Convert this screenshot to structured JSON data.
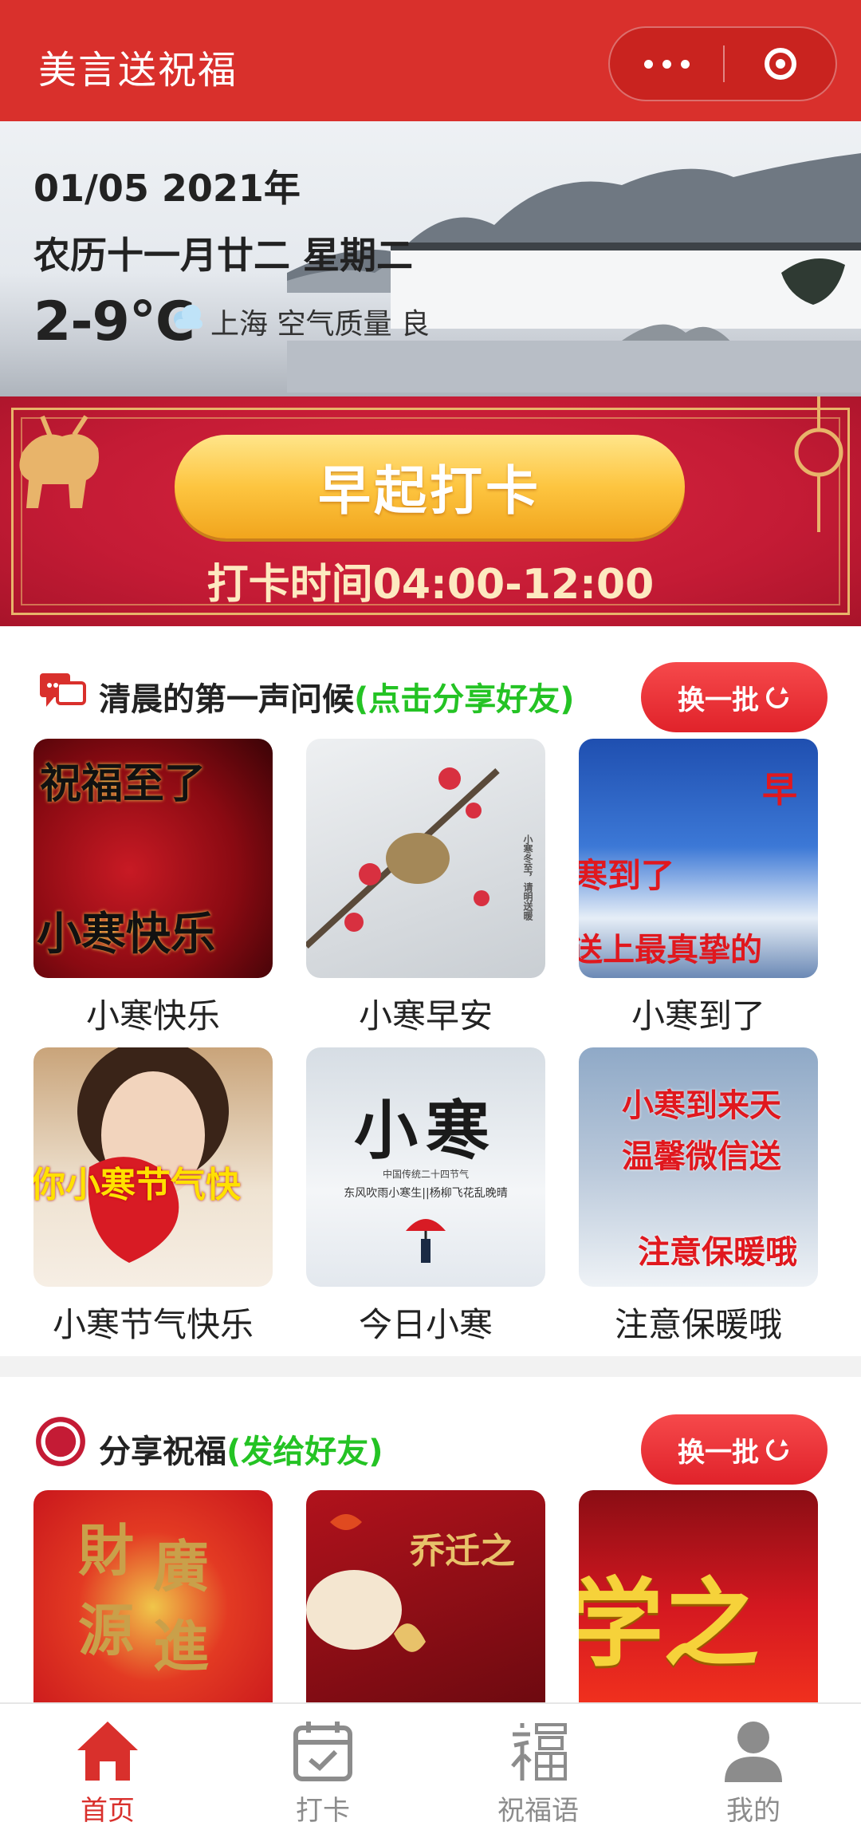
{
  "header": {
    "title": "美言送祝福"
  },
  "weather": {
    "date": "01/05 2021年",
    "lunar": "农历十一月廿二  星期二",
    "temperature": "2-9°C",
    "location": "上海  空气质量  良"
  },
  "checkin": {
    "button_label": "早起打卡",
    "time_text": "打卡时间04:00-12:00"
  },
  "greeting_section": {
    "title": "清晨的第一声问候",
    "title_highlight": "(点击分享好友)",
    "refresh_label": "换一批",
    "items": [
      {
        "caption": "小寒快乐",
        "art": [
          "祝福至了",
          "小寒快乐"
        ]
      },
      {
        "caption": "小寒早安",
        "art": [
          "小寒冬至，请明送暖"
        ]
      },
      {
        "caption": "小寒到了",
        "art": [
          "早",
          "寒到了",
          "送上最真挚的"
        ]
      },
      {
        "caption": "小寒节气快乐",
        "art": [
          "你小寒节气快"
        ]
      },
      {
        "caption": "今日小寒",
        "art": [
          "小",
          "寒",
          "中国传统二十四节气",
          "东风吹雨小寒生||杨柳飞花乱晚晴"
        ]
      },
      {
        "caption": "注意保暖哦",
        "art": [
          "小寒到来天",
          "温馨微信送",
          "注意保暖哦"
        ]
      }
    ]
  },
  "share_section": {
    "title": "分享祝福",
    "title_highlight": "(发给好友)",
    "refresh_label": "换一批",
    "items": [
      {
        "art": [
          "財",
          "廣",
          "源",
          "進"
        ]
      },
      {
        "art": [
          "乔迁之"
        ]
      },
      {
        "art": [
          "学之"
        ]
      }
    ]
  },
  "tabbar": {
    "tabs": [
      {
        "label": "首页",
        "icon": "home-icon"
      },
      {
        "label": "打卡",
        "icon": "calendar-check-icon"
      },
      {
        "label": "祝福语",
        "icon": "fu-character-icon"
      },
      {
        "label": "我的",
        "icon": "user-icon"
      }
    ],
    "active_color": "#d9302c",
    "inactive_color": "#8c8c8c"
  },
  "colors": {
    "brand_red": "#d9302c",
    "highlight_green": "#24c324",
    "gold": "#fdc540"
  }
}
